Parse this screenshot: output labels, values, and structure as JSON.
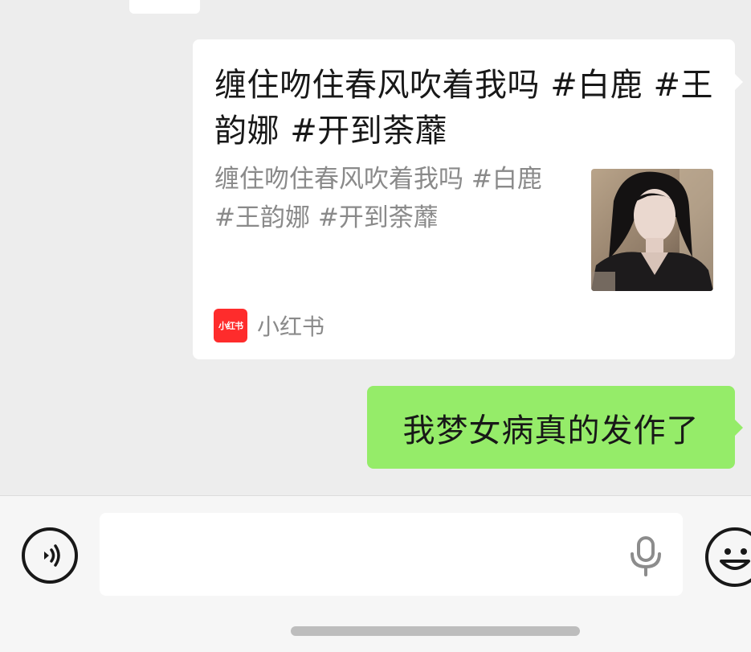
{
  "messages": {
    "shared_card": {
      "title": "缠住吻住春风吹着我吗 #白鹿  #王韵娜  #开到荼蘼",
      "description": "缠住吻住春风吹着我吗 #白鹿  #王韵娜  #开到荼蘼",
      "source_logo_text": "小红书",
      "source_name": "小红书",
      "source_color": "#fe2c2c"
    },
    "my_message": {
      "text": "我梦女病真的发作了",
      "bubble_color": "#95ec69"
    }
  },
  "input_bar": {
    "value": "",
    "placeholder": ""
  },
  "icons": {
    "voice": "voice-mode-icon",
    "mic": "mic-icon",
    "emoji": "emoji-icon"
  }
}
